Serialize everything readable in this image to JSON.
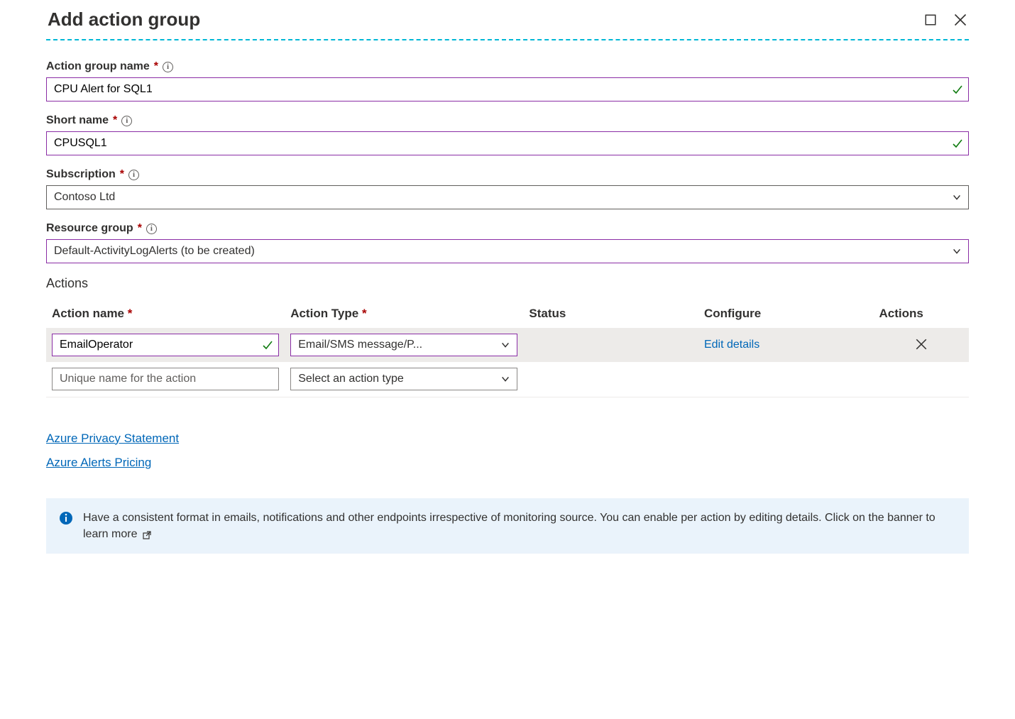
{
  "header": {
    "title": "Add action group"
  },
  "fields": {
    "action_group_name": {
      "label": "Action group name",
      "value": "CPU Alert for SQL1"
    },
    "short_name": {
      "label": "Short name",
      "value": "CPUSQL1"
    },
    "subscription": {
      "label": "Subscription",
      "value": "Contoso Ltd"
    },
    "resource_group": {
      "label": "Resource group",
      "value": "Default-ActivityLogAlerts (to be created)"
    }
  },
  "actions_section": {
    "title": "Actions",
    "columns": {
      "name": "Action name",
      "type": "Action Type",
      "status": "Status",
      "configure": "Configure",
      "actions": "Actions"
    },
    "rows": [
      {
        "name": "EmailOperator",
        "type": "Email/SMS message/P...",
        "status": "",
        "configure": "Edit details"
      }
    ],
    "new_row": {
      "name_placeholder": "Unique name for the action",
      "type_placeholder": "Select an action type"
    }
  },
  "links": {
    "privacy": "Azure Privacy Statement",
    "pricing": "Azure Alerts Pricing"
  },
  "banner": {
    "text": "Have a consistent format in emails, notifications and other endpoints irrespective of monitoring source. You can enable per action by editing details. Click on the banner to learn more"
  }
}
